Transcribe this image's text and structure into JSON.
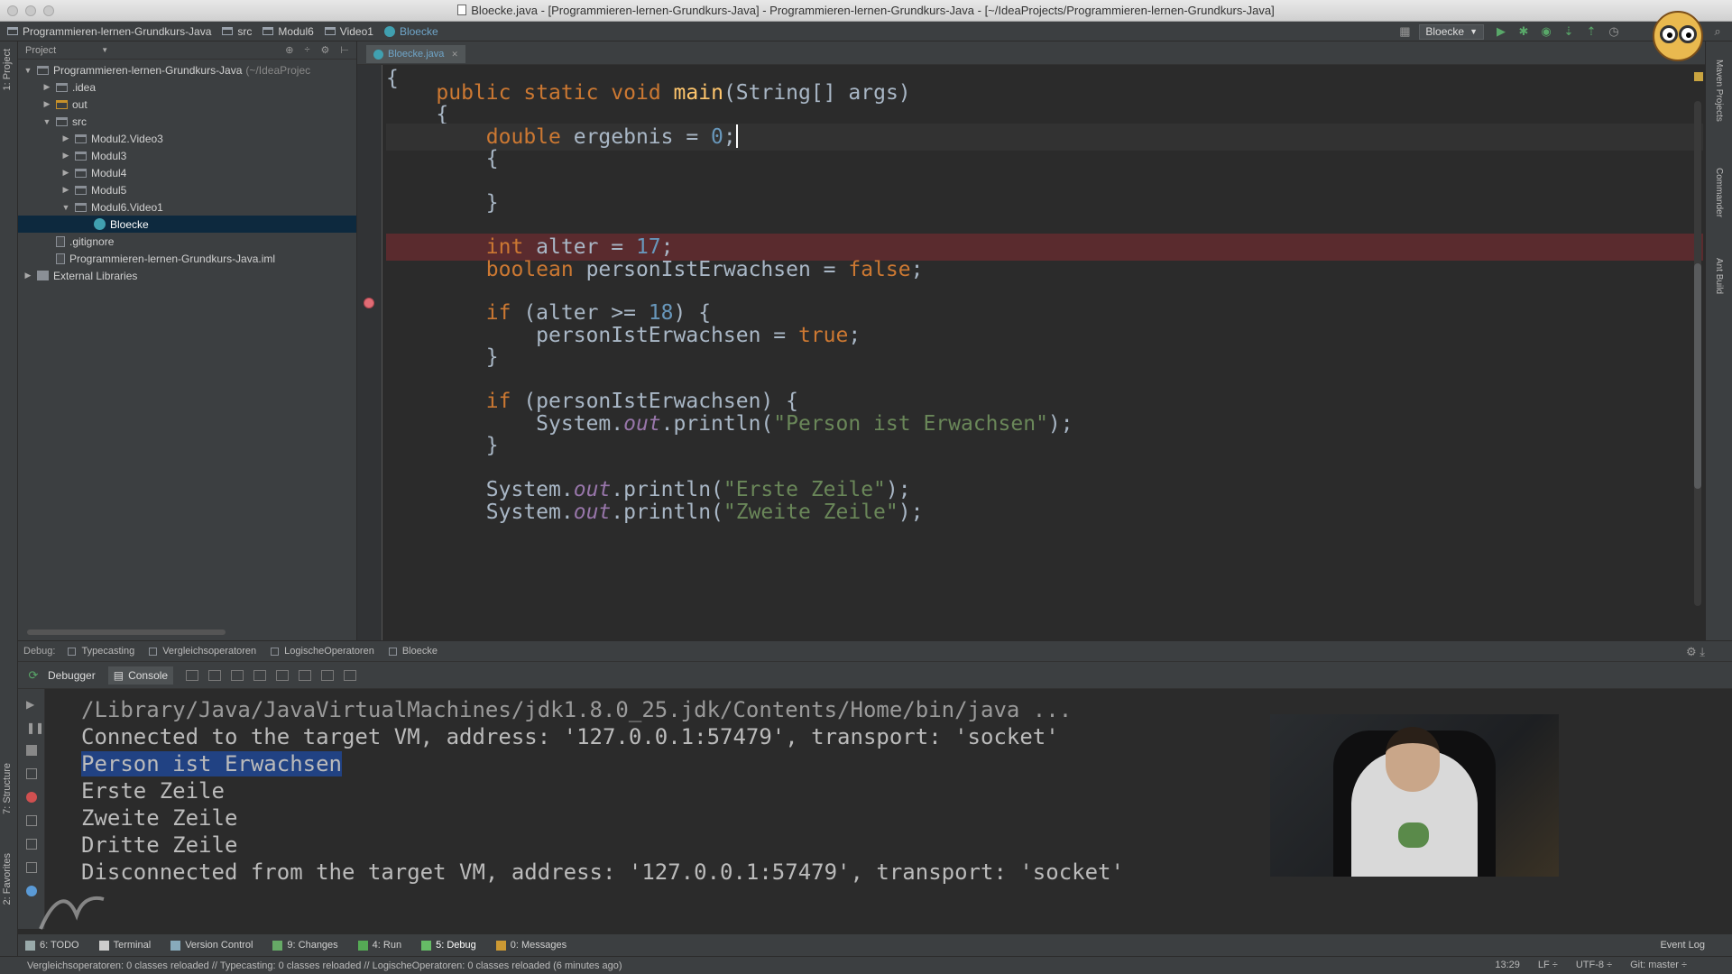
{
  "window": {
    "title": "Bloecke.java - [Programmieren-lernen-Grundkurs-Java] - Programmieren-lernen-Grundkurs-Java - [~/IdeaProjects/Programmieren-lernen-Grundkurs-Java]"
  },
  "breadcrumbs": [
    "Programmieren-lernen-Grundkurs-Java",
    "src",
    "Modul6",
    "Video1",
    "Bloecke"
  ],
  "run_config": "Bloecke",
  "left_tabs": {
    "project": "1: Project",
    "structure": "7: Structure",
    "favorites": "2: Favorites"
  },
  "right_tabs": {
    "maven": "Maven Projects",
    "commander": "Commander",
    "ant": "Ant Build"
  },
  "project_panel": {
    "header": "Project",
    "tree": [
      {
        "label": "Programmieren-lernen-Grundkurs-Java",
        "suffix": "(~/IdeaProjec",
        "indent": 0,
        "arrow": "▼",
        "icon": "folder"
      },
      {
        "label": ".idea",
        "indent": 1,
        "arrow": "▶",
        "icon": "folder"
      },
      {
        "label": "out",
        "indent": 1,
        "arrow": "▶",
        "icon": "folder-orange"
      },
      {
        "label": "src",
        "indent": 1,
        "arrow": "▼",
        "icon": "folder"
      },
      {
        "label": "Modul2.Video3",
        "indent": 2,
        "arrow": "▶",
        "icon": "folder"
      },
      {
        "label": "Modul3",
        "indent": 2,
        "arrow": "▶",
        "icon": "folder"
      },
      {
        "label": "Modul4",
        "indent": 2,
        "arrow": "▶",
        "icon": "folder"
      },
      {
        "label": "Modul5",
        "indent": 2,
        "arrow": "▶",
        "icon": "folder"
      },
      {
        "label": "Modul6.Video1",
        "indent": 2,
        "arrow": "▼",
        "icon": "folder"
      },
      {
        "label": "Bloecke",
        "indent": 3,
        "arrow": "",
        "icon": "class",
        "selected": true
      },
      {
        "label": ".gitignore",
        "indent": 1,
        "arrow": "",
        "icon": "file"
      },
      {
        "label": "Programmieren-lernen-Grundkurs-Java.iml",
        "indent": 1,
        "arrow": "",
        "icon": "file"
      },
      {
        "label": "External Libraries",
        "indent": 0,
        "arrow": "▶",
        "icon": "library"
      }
    ]
  },
  "editor": {
    "tab": "Bloecke.java",
    "lines": [
      "{",
      "    public static void main(String[] args)",
      "    {",
      "        double ergebnis = 0;",
      "        {",
      "",
      "        }",
      "",
      "        int alter = 17;",
      "        boolean personIstErwachsen = false;",
      "",
      "        if (alter >= 18) {",
      "            personIstErwachsen = true;",
      "        }",
      "",
      "        if (personIstErwachsen) {",
      "            System.out.println(\"Person ist Erwachsen\");",
      "        }",
      "",
      "        System.out.println(\"Erste Zeile\");",
      "        System.out.println(\"Zweite Zeile\");"
    ]
  },
  "debug": {
    "label": "Debug:",
    "tabs": [
      "Typecasting",
      "Vergleichsoperatoren",
      "LogischeOperatoren",
      "Bloecke"
    ],
    "subtabs": {
      "debugger": "Debugger",
      "console": "Console"
    },
    "console_lines": [
      "/Library/Java/JavaVirtualMachines/jdk1.8.0_25.jdk/Contents/Home/bin/java ...",
      "Connected to the target VM, address: '127.0.0.1:57479', transport: 'socket'",
      "Person ist Erwachsen",
      "Erste Zeile",
      "Zweite Zeile",
      "Dritte Zeile",
      "Disconnected from the target VM, address: '127.0.0.1:57479', transport: 'socket'"
    ]
  },
  "bottom_tools": [
    {
      "label": "6: TODO",
      "icon": "todo-icon"
    },
    {
      "label": "Terminal",
      "icon": "terminal-icon"
    },
    {
      "label": "Version Control",
      "icon": "version-control-icon"
    },
    {
      "label": "9: Changes",
      "icon": "changes-icon"
    },
    {
      "label": "4: Run",
      "icon": "run-icon"
    },
    {
      "label": "5: Debug",
      "icon": "debug-icon",
      "selected": true
    },
    {
      "label": "0: Messages",
      "icon": "messages-icon"
    }
  ],
  "event_log": "Event Log",
  "status": {
    "message": "Vergleichsoperatoren: 0 classes reloaded // Typecasting: 0 classes reloaded // LogischeOperatoren: 0 classes reloaded (6 minutes ago)",
    "position": "13:29",
    "line_sep": "LF ÷",
    "encoding": "UTF-8 ÷",
    "vcs": "Git: master ÷"
  }
}
